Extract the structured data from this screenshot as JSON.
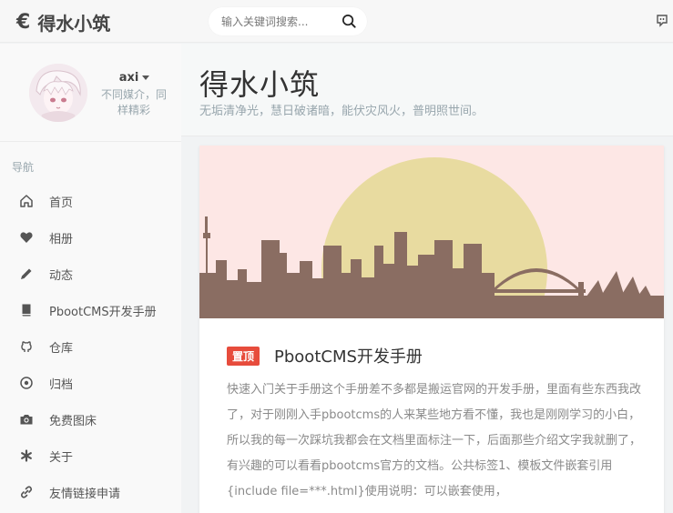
{
  "header": {
    "brand_symbol": "€",
    "brand_name": "得水小筑",
    "search_placeholder": "输入关键词搜索..."
  },
  "profile": {
    "name": "axi",
    "motto": "不同媒介，同样精彩"
  },
  "nav": {
    "heading": "导航",
    "items": [
      {
        "label": "首页",
        "icon": "home-icon"
      },
      {
        "label": "相册",
        "icon": "heart-icon"
      },
      {
        "label": "动态",
        "icon": "pencil-icon"
      },
      {
        "label": "PbootCMS开发手册",
        "icon": "book-icon"
      },
      {
        "label": "仓库",
        "icon": "github-icon"
      },
      {
        "label": "归档",
        "icon": "target-icon"
      },
      {
        "label": "免费图床",
        "icon": "camera-icon"
      },
      {
        "label": "关于",
        "icon": "asterisk-icon"
      },
      {
        "label": "友情链接申请",
        "icon": "link-icon"
      }
    ]
  },
  "main": {
    "title": "得水小筑",
    "subtitle": "无垢清净光，慧日破诸暗，能伏灾风火，普明照世间。"
  },
  "post": {
    "badge": "置顶",
    "title": "PbootCMS开发手册",
    "excerpt": "快速入门关于手册这个手册差不多都是搬运官网的开发手册，里面有些东西我改了，对于刚刚入手pbootcms的人来某些地方看不懂，我也是刚刚学习的小白，所以我的每一次踩坑我都会在文档里面标注一下，后面那些介绍文字我就删了，有兴趣的可以看看pbootcms官方的文档。公共标签1、模板文件嵌套引用{include file=***.html}使用说明：可以嵌套使用，"
  },
  "colors": {
    "banner_bg": "#fde7e5",
    "sun": "#e8dba0",
    "skyline": "#8a6d62",
    "badge": "#e74c3c"
  }
}
